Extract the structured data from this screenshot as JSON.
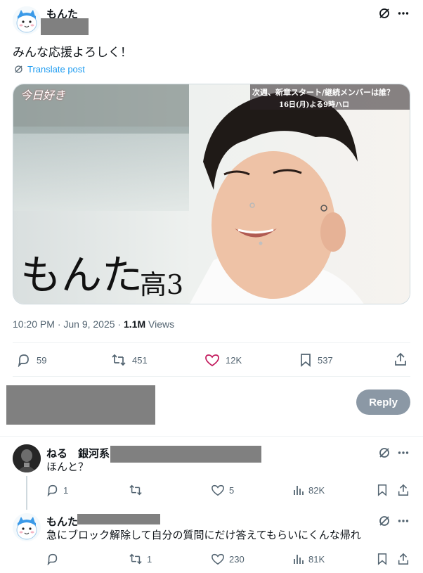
{
  "tweet": {
    "author_name": "もんた",
    "text": "みんな応援よろしく！",
    "translate_label": "Translate post",
    "media": {
      "top_banner": "次週、新章スタート/継続メンバーは誰？",
      "top_banner_sub": "16日(月)よる9時ハロ",
      "logo": "今日好き",
      "caption_name": "もんた",
      "caption_grade": "高3"
    },
    "time": "10:20 PM · Jun 9, 2025 ·",
    "views_count": "1.1M",
    "views_label": "Views",
    "stats": {
      "replies": "59",
      "reposts": "451",
      "likes": "12K",
      "bookmarks": "537"
    }
  },
  "compose": {
    "reply_label": "Reply"
  },
  "replies": [
    {
      "name": "ねる　銀河系",
      "text": "ほんと？",
      "replies": "1",
      "reposts": "",
      "likes": "5",
      "views": "82K"
    },
    {
      "name": "もんた",
      "text": "急にブロック解除して自分の質問にだけ答えてもらいにくんな帰れ",
      "replies": "",
      "reposts": "1",
      "likes": "230",
      "views": "81K"
    }
  ],
  "colors": {
    "accent": "#1d9bf0",
    "muted": "#536471",
    "like": "#f91880",
    "reply_button": "#8b98a5"
  }
}
